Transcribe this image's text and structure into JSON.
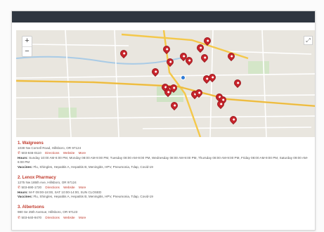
{
  "topbar": {
    "items": [
      "",
      "",
      ""
    ]
  },
  "map": {
    "zoom_in": "+",
    "zoom_out": "−",
    "fullscreen": "⤢",
    "pin_count": 24,
    "labels": [
      "",
      "",
      "",
      ""
    ]
  },
  "listings": [
    {
      "title": "1. Walgreens",
      "address": "1038 Nw Cornell Road, Hillsboro, OR 97124",
      "phone": "503-846-0110",
      "directions": "Directions",
      "website": "Website",
      "more": "More",
      "hours_label": "Hours:",
      "hours": "Sunday 10:00 AM-6:00 PM, Monday 08:00 AM-9:00 PM, Tuesday 08:00 AM-9:00 PM, Wednesday 08:00 AM-9:00 PM, Thursday 08:00 AM-9:00 PM, Friday 08:00 AM-9:00 PM, Saturday 09:00 AM-6:00 PM",
      "vaccines_label": "Vaccines:",
      "vaccines": "Flu, Shingles, Hepatitis A, Hepatitis B, Meningitis, HPV, Pneumonia, Tdap, Covid-19"
    },
    {
      "title": "2. Lenox Pharmacy",
      "address": "1275 Nw 185th Ave, Hillsboro, OR 97124",
      "phone": "503-690-1720",
      "directions": "Directions",
      "website": "Website",
      "more": "More",
      "hours_label": "Hours:",
      "hours": "M-F 09:00-18:00, SAT 10:00-14:00, SUN CLOSED",
      "vaccines_label": "Vaccines:",
      "vaccines": "Flu, Shingles, Hepatitis A, Hepatitis B, Meningitis, HPV, Pneumonia, Tdap, Covid-19"
    },
    {
      "title": "3. Albertsons",
      "address": "980 Se 25th Avenue, Hillsboro, OR 97123",
      "phone": "503-640-9470",
      "directions": "Directions",
      "website": "Website",
      "more": "More"
    }
  ]
}
